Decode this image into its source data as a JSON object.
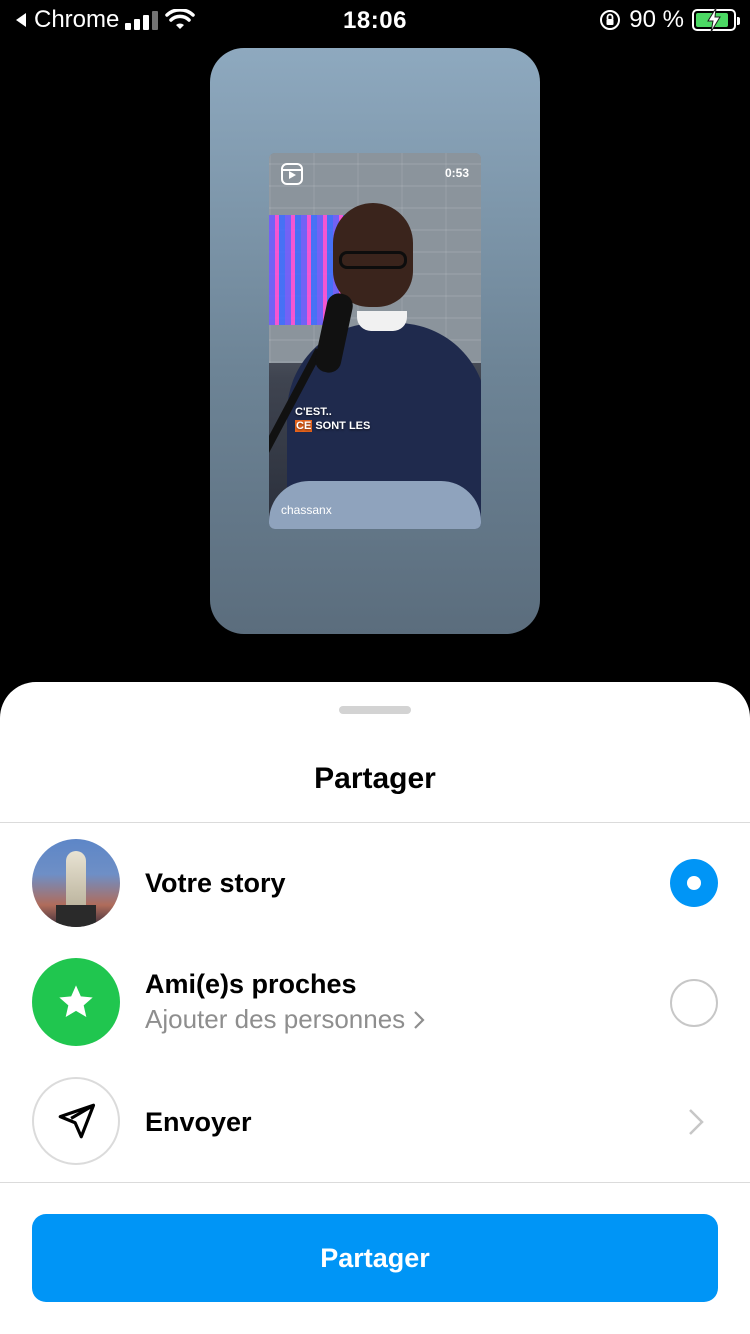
{
  "status_bar": {
    "back_app": "Chrome",
    "time": "18:06",
    "battery_percent": "90 %",
    "battery_level": 0.9
  },
  "story_preview": {
    "reel_duration": "0:53",
    "caption_line1": "C'EST..",
    "caption_highlight": "CE",
    "caption_rest": "SONT LES",
    "username": "chassanx"
  },
  "sheet": {
    "title": "Partager",
    "options": [
      {
        "label": "Votre story",
        "selected": true
      },
      {
        "label": "Ami(e)s proches",
        "sublabel": "Ajouter des personnes",
        "selected": false
      },
      {
        "label": "Envoyer"
      }
    ],
    "share_button": "Partager"
  },
  "colors": {
    "accent": "#0095f6",
    "close_friends": "#20c64f"
  }
}
